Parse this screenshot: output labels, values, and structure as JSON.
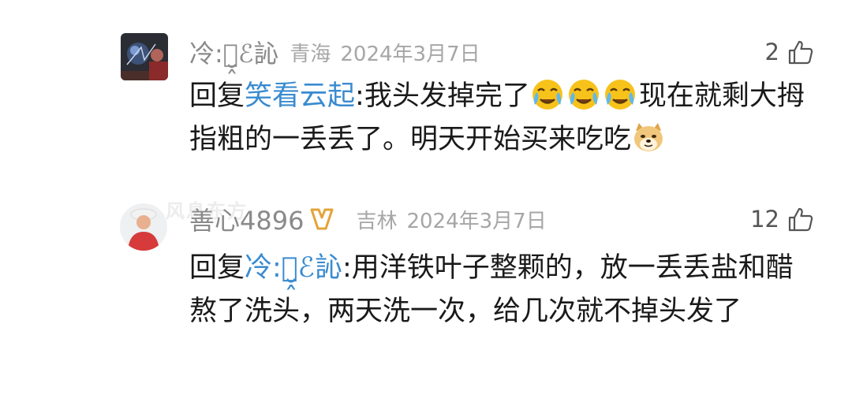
{
  "comments": [
    {
      "username": "冷:ｃ̮̭ℰ訫",
      "location": "青海",
      "time": "2024年3月7日",
      "likes": "2",
      "reply_prefix": "回复",
      "mention": "笑看云起",
      "text_a": ":我头发掉完了",
      "text_b": "现在就剩大拇指粗的一丢丢了。明天开始买来吃吃",
      "emojis": [
        "crying-face",
        "crying-face",
        "crying-face",
        "doge"
      ]
    },
    {
      "username": "善心4896",
      "location": "吉林",
      "time": "2024年3月7日",
      "likes": "12",
      "reply_prefix": "回复",
      "mention": "冷:ｃ̮̭ℰ訫",
      "text": ":用洋铁叶子整颗的，放一丢丢盐和醋熬了洗头，两天洗一次，给几次就不掉头发了"
    }
  ],
  "watermark": "风息东方"
}
